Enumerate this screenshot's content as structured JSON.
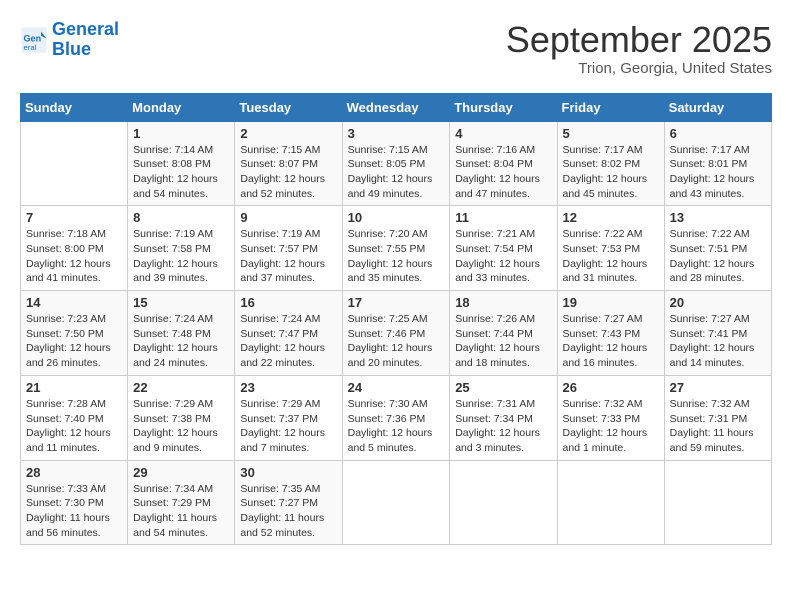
{
  "header": {
    "logo_line1": "General",
    "logo_line2": "Blue",
    "month_year": "September 2025",
    "location": "Trion, Georgia, United States"
  },
  "weekdays": [
    "Sunday",
    "Monday",
    "Tuesday",
    "Wednesday",
    "Thursday",
    "Friday",
    "Saturday"
  ],
  "weeks": [
    [
      {
        "day": "",
        "info": ""
      },
      {
        "day": "1",
        "info": "Sunrise: 7:14 AM\nSunset: 8:08 PM\nDaylight: 12 hours and 54 minutes."
      },
      {
        "day": "2",
        "info": "Sunrise: 7:15 AM\nSunset: 8:07 PM\nDaylight: 12 hours and 52 minutes."
      },
      {
        "day": "3",
        "info": "Sunrise: 7:15 AM\nSunset: 8:05 PM\nDaylight: 12 hours and 49 minutes."
      },
      {
        "day": "4",
        "info": "Sunrise: 7:16 AM\nSunset: 8:04 PM\nDaylight: 12 hours and 47 minutes."
      },
      {
        "day": "5",
        "info": "Sunrise: 7:17 AM\nSunset: 8:02 PM\nDaylight: 12 hours and 45 minutes."
      },
      {
        "day": "6",
        "info": "Sunrise: 7:17 AM\nSunset: 8:01 PM\nDaylight: 12 hours and 43 minutes."
      }
    ],
    [
      {
        "day": "7",
        "info": "Sunrise: 7:18 AM\nSunset: 8:00 PM\nDaylight: 12 hours and 41 minutes."
      },
      {
        "day": "8",
        "info": "Sunrise: 7:19 AM\nSunset: 7:58 PM\nDaylight: 12 hours and 39 minutes."
      },
      {
        "day": "9",
        "info": "Sunrise: 7:19 AM\nSunset: 7:57 PM\nDaylight: 12 hours and 37 minutes."
      },
      {
        "day": "10",
        "info": "Sunrise: 7:20 AM\nSunset: 7:55 PM\nDaylight: 12 hours and 35 minutes."
      },
      {
        "day": "11",
        "info": "Sunrise: 7:21 AM\nSunset: 7:54 PM\nDaylight: 12 hours and 33 minutes."
      },
      {
        "day": "12",
        "info": "Sunrise: 7:22 AM\nSunset: 7:53 PM\nDaylight: 12 hours and 31 minutes."
      },
      {
        "day": "13",
        "info": "Sunrise: 7:22 AM\nSunset: 7:51 PM\nDaylight: 12 hours and 28 minutes."
      }
    ],
    [
      {
        "day": "14",
        "info": "Sunrise: 7:23 AM\nSunset: 7:50 PM\nDaylight: 12 hours and 26 minutes."
      },
      {
        "day": "15",
        "info": "Sunrise: 7:24 AM\nSunset: 7:48 PM\nDaylight: 12 hours and 24 minutes."
      },
      {
        "day": "16",
        "info": "Sunrise: 7:24 AM\nSunset: 7:47 PM\nDaylight: 12 hours and 22 minutes."
      },
      {
        "day": "17",
        "info": "Sunrise: 7:25 AM\nSunset: 7:46 PM\nDaylight: 12 hours and 20 minutes."
      },
      {
        "day": "18",
        "info": "Sunrise: 7:26 AM\nSunset: 7:44 PM\nDaylight: 12 hours and 18 minutes."
      },
      {
        "day": "19",
        "info": "Sunrise: 7:27 AM\nSunset: 7:43 PM\nDaylight: 12 hours and 16 minutes."
      },
      {
        "day": "20",
        "info": "Sunrise: 7:27 AM\nSunset: 7:41 PM\nDaylight: 12 hours and 14 minutes."
      }
    ],
    [
      {
        "day": "21",
        "info": "Sunrise: 7:28 AM\nSunset: 7:40 PM\nDaylight: 12 hours and 11 minutes."
      },
      {
        "day": "22",
        "info": "Sunrise: 7:29 AM\nSunset: 7:38 PM\nDaylight: 12 hours and 9 minutes."
      },
      {
        "day": "23",
        "info": "Sunrise: 7:29 AM\nSunset: 7:37 PM\nDaylight: 12 hours and 7 minutes."
      },
      {
        "day": "24",
        "info": "Sunrise: 7:30 AM\nSunset: 7:36 PM\nDaylight: 12 hours and 5 minutes."
      },
      {
        "day": "25",
        "info": "Sunrise: 7:31 AM\nSunset: 7:34 PM\nDaylight: 12 hours and 3 minutes."
      },
      {
        "day": "26",
        "info": "Sunrise: 7:32 AM\nSunset: 7:33 PM\nDaylight: 12 hours and 1 minute."
      },
      {
        "day": "27",
        "info": "Sunrise: 7:32 AM\nSunset: 7:31 PM\nDaylight: 11 hours and 59 minutes."
      }
    ],
    [
      {
        "day": "28",
        "info": "Sunrise: 7:33 AM\nSunset: 7:30 PM\nDaylight: 11 hours and 56 minutes."
      },
      {
        "day": "29",
        "info": "Sunrise: 7:34 AM\nSunset: 7:29 PM\nDaylight: 11 hours and 54 minutes."
      },
      {
        "day": "30",
        "info": "Sunrise: 7:35 AM\nSunset: 7:27 PM\nDaylight: 11 hours and 52 minutes."
      },
      {
        "day": "",
        "info": ""
      },
      {
        "day": "",
        "info": ""
      },
      {
        "day": "",
        "info": ""
      },
      {
        "day": "",
        "info": ""
      }
    ]
  ]
}
